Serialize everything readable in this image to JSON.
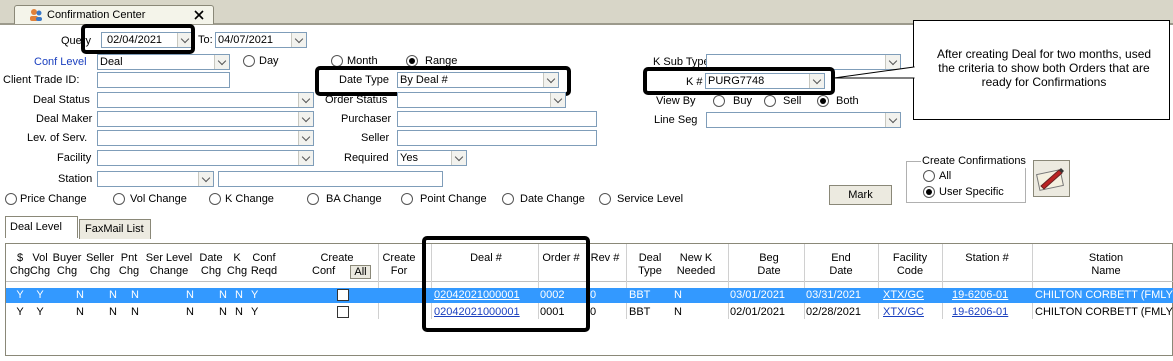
{
  "window": {
    "tab_title": "Confirmation Center"
  },
  "query": {
    "query_label": "Query",
    "from_date": "02/04/2021",
    "to_label": "To:",
    "to_date": "04/07/2021",
    "conf_level_label": "Conf Level",
    "conf_level_value": "Deal",
    "day_label": "Day",
    "month_label": "Month",
    "range_label": "Range",
    "k_sub_type_label": "K Sub Type",
    "k_sub_type_value": "",
    "client_trade_id_label": "Client Trade ID:",
    "client_trade_id_value": "",
    "date_type_label": "Date Type",
    "date_type_value": "By Deal #",
    "k_label": "K #",
    "k_value": "PURG7748",
    "deal_status_label": "Deal Status",
    "order_status_label": "Order Status",
    "view_by_label": "View By",
    "buy_label": "Buy",
    "sell_label": "Sell",
    "both_label": "Both",
    "deal_maker_label": "Deal Maker",
    "purchaser_label": "Purchaser",
    "line_seg_label": "Line Seg",
    "lev_serv_label": "Lev. of Serv.",
    "seller_label": "Seller",
    "facility_label": "Facility",
    "required_label": "Required",
    "required_value": "Yes",
    "station_label": "Station"
  },
  "changes": {
    "price": "Price Change",
    "vol": "Vol Change",
    "k": "K Change",
    "ba": "BA Change",
    "point": "Point Change",
    "date": "Date Change",
    "service": "Service Level"
  },
  "create_confirmations": {
    "title": "Create Confirmations",
    "all_label": "All",
    "user_specific_label": "User Specific",
    "mark_label": "Mark"
  },
  "callout": {
    "text": "After creating Deal for two months, used the criteria to show both Orders that are ready for Confirmations"
  },
  "tabs": {
    "deal_level": "Deal Level",
    "faxmail_list": "FaxMail List"
  },
  "grid": {
    "headers": {
      "dollar_chg": [
        "$",
        "Chg"
      ],
      "vol_chg": [
        "Vol",
        "Chg"
      ],
      "buyer_chg": [
        "Buyer",
        "Chg"
      ],
      "seller_chg": [
        "Seller",
        "Chg"
      ],
      "pnt_chg": [
        "Pnt",
        "Chg"
      ],
      "ser_level_change": [
        "Ser Level",
        "Change"
      ],
      "date_chg": [
        "Date",
        "Chg"
      ],
      "k_chg": [
        "K",
        "Chg"
      ],
      "conf_reqd": [
        "Conf",
        "Reqd"
      ],
      "create_conf": [
        "Create",
        "Conf"
      ],
      "all_btn": "All",
      "create_for": [
        "Create",
        "For"
      ],
      "deal_num": "Deal #",
      "order_num": "Order #",
      "rev_num": "Rev #",
      "deal_type": [
        "Deal",
        "Type"
      ],
      "new_k_needed": [
        "New K",
        "Needed"
      ],
      "beg_date": [
        "Beg",
        "Date"
      ],
      "end_date": [
        "End",
        "Date"
      ],
      "facility_code": [
        "Facility",
        "Code"
      ],
      "station_num": "Station #",
      "station_name": [
        "Station",
        "Name"
      ]
    },
    "rows": [
      {
        "dollar": "Y",
        "vol": "Y",
        "buyer": "N",
        "seller": "N",
        "pnt": "N",
        "ser": "N",
        "date": "N",
        "k": "N",
        "conf": "Y",
        "deal": "02042021000001",
        "order": "0002",
        "rev": "0",
        "type": "BBT",
        "newk": "N",
        "beg": "03/01/2021",
        "end": "03/31/2021",
        "fac": "XTX/GC",
        "station": "19-6206-01",
        "name": "CHILTON CORBETT (FMLY"
      },
      {
        "dollar": "Y",
        "vol": "Y",
        "buyer": "N",
        "seller": "N",
        "pnt": "N",
        "ser": "N",
        "date": "N",
        "k": "N",
        "conf": "Y",
        "deal": "02042021000001",
        "order": "0001",
        "rev": "0",
        "type": "BBT",
        "newk": "N",
        "beg": "02/01/2021",
        "end": "02/28/2021",
        "fac": "XTX/GC",
        "station": "19-6206-01",
        "name": "CHILTON CORBETT (FMLY"
      }
    ]
  },
  "colors": {
    "selected_row": "#3399ff",
    "link": "#1a3fbf",
    "label_blue": "#1a3fbf"
  }
}
